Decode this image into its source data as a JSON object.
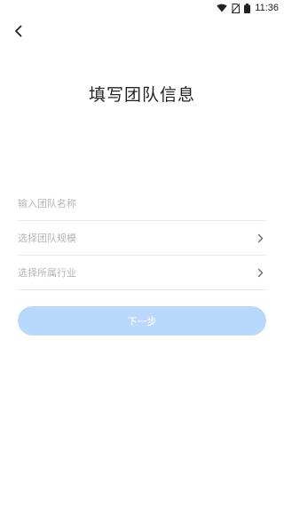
{
  "status_bar": {
    "time": "11:36",
    "icons": [
      "wifi-icon",
      "no-sim-icon",
      "battery-icon"
    ]
  },
  "header": {
    "back_icon": "chevron-left-icon",
    "title": "填写团队信息"
  },
  "form": {
    "team_name": {
      "placeholder": "输入团队名称",
      "value": ""
    },
    "team_size": {
      "label": "选择团队规模",
      "icon": "chevron-right-icon"
    },
    "industry": {
      "label": "选择所属行业",
      "icon": "chevron-right-icon"
    }
  },
  "next_button": {
    "label": "下一步",
    "color": "#b9d8fb"
  }
}
